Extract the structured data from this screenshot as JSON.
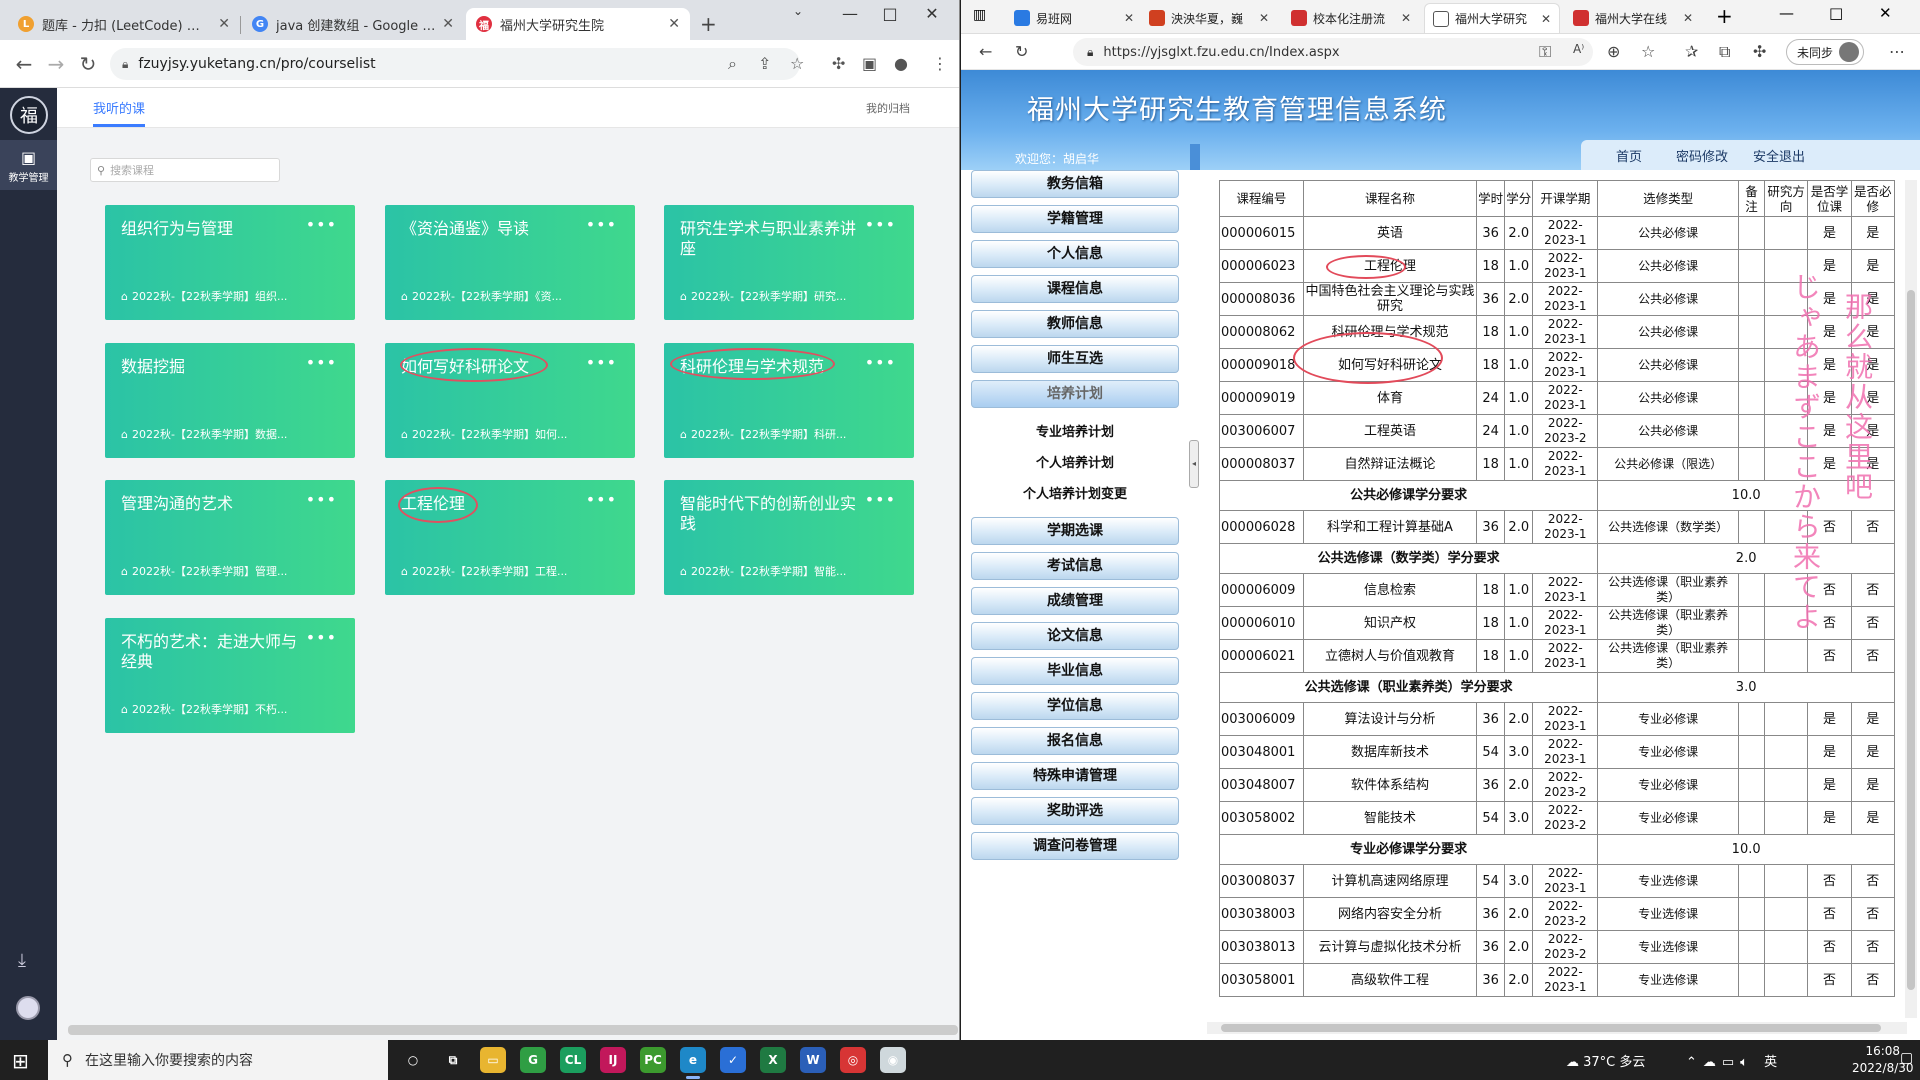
{
  "left_browser": {
    "tabs": [
      {
        "title": "题库 - 力扣 (LeetCode) 全球极",
        "color": "#f0a030"
      },
      {
        "title": "java 创建数组 - Google 搜索",
        "color": "#4285f4"
      },
      {
        "title": "福州大学研究生院",
        "color": "#e03040"
      }
    ],
    "url": "fzuyjsy.yuketang.cn/pro/courselist",
    "page": {
      "side_label": "教学管理",
      "tab_label": "我听的课",
      "archive_label": "我的归档",
      "search_placeholder": "搜索课程",
      "courses": [
        {
          "title": "组织行为与管理",
          "sub": "2022秋-【22秋季学期】组织..."
        },
        {
          "title": "《资治通鉴》导读",
          "sub": "2022秋-【22秋季学期】《资..."
        },
        {
          "title": "研究生学术与职业素养讲座",
          "sub": "2022秋-【22秋季学期】研究..."
        },
        {
          "title": "数据挖掘",
          "sub": "2022秋-【22秋季学期】数据..."
        },
        {
          "title": "如何写好科研论文",
          "sub": "2022秋-【22秋季学期】如何..."
        },
        {
          "title": "科研伦理与学术规范",
          "sub": "2022秋-【22秋季学期】科研..."
        },
        {
          "title": "管理沟通的艺术",
          "sub": "2022秋-【22秋季学期】管理..."
        },
        {
          "title": "工程伦理",
          "sub": "2022秋-【22秋季学期】工程..."
        },
        {
          "title": "智能时代下的创新创业实践",
          "sub": "2022秋-【22秋季学期】智能..."
        },
        {
          "title": "不朽的艺术：走进大师与经典",
          "sub": "2022秋-【22秋季学期】不朽..."
        }
      ]
    }
  },
  "right_browser": {
    "tabs": [
      {
        "title": "易班网",
        "color": "#2a7ae2"
      },
      {
        "title": "泱泱华夏，巍",
        "color": "#d04020"
      },
      {
        "title": "校本化注册流",
        "color": "#d03030"
      },
      {
        "title": "福州大学研究",
        "color": "#ffffff"
      },
      {
        "title": "福州大学在线",
        "color": "#d03030"
      }
    ],
    "url": "https://yjsglxt.fzu.edu.cn/Index.aspx",
    "sync_label": "未同步",
    "page": {
      "title": "福州大学研究生教育管理信息系统",
      "welcome": "欢迎您：胡启华",
      "nav": [
        "首页",
        "密码修改",
        "安全退出"
      ],
      "menu_top": [
        "教务信箱",
        "学籍管理",
        "个人信息",
        "课程信息",
        "教师信息",
        "师生互选",
        "培养计划"
      ],
      "menu_sub": [
        "专业培养计划",
        "个人培养计划",
        "个人培养计划变更"
      ],
      "menu_bottom": [
        "学期选课",
        "考试信息",
        "成绩管理",
        "论文信息",
        "毕业信息",
        "学位信息",
        "报名信息",
        "特殊申请管理",
        "奖助评选",
        "调查问卷管理"
      ],
      "table_headers": [
        "课程编号",
        "课程名称",
        "学时",
        "学分",
        "开课学期",
        "选修类型",
        "备注",
        "研究方向",
        "是否学位课",
        "是否必修"
      ],
      "rows": [
        {
          "kind": "c",
          "code": "000006015",
          "name": "英语",
          "hours": "36",
          "credit": "2.0",
          "term": "2022-2023-1",
          "type": "公共必修课",
          "note": "",
          "dir": "",
          "degree": "是",
          "req": "是"
        },
        {
          "kind": "c",
          "code": "000006023",
          "name": "工程伦理",
          "hours": "18",
          "credit": "1.0",
          "term": "2022-2023-1",
          "type": "公共必修课",
          "note": "",
          "dir": "",
          "degree": "是",
          "req": "是"
        },
        {
          "kind": "c",
          "code": "000008036",
          "name": "中国特色社会主义理论与实践研究",
          "hours": "36",
          "credit": "2.0",
          "term": "2022-2023-1",
          "type": "公共必修课",
          "note": "",
          "dir": "",
          "degree": "是",
          "req": "是"
        },
        {
          "kind": "c",
          "code": "000008062",
          "name": "科研伦理与学术规范",
          "hours": "18",
          "credit": "1.0",
          "term": "2022-2023-1",
          "type": "公共必修课",
          "note": "",
          "dir": "",
          "degree": "是",
          "req": "是"
        },
        {
          "kind": "c",
          "code": "000009018",
          "name": "如何写好科研论文",
          "hours": "18",
          "credit": "1.0",
          "term": "2022-2023-1",
          "type": "公共必修课",
          "note": "",
          "dir": "",
          "degree": "是",
          "req": "是"
        },
        {
          "kind": "c",
          "code": "000009019",
          "name": "体育",
          "hours": "24",
          "credit": "1.0",
          "term": "2022-2023-1",
          "type": "公共必修课",
          "note": "",
          "dir": "",
          "degree": "是",
          "req": "是"
        },
        {
          "kind": "c",
          "code": "003006007",
          "name": "工程英语",
          "hours": "24",
          "credit": "1.0",
          "term": "2022-2023-2",
          "type": "公共必修课",
          "note": "",
          "dir": "",
          "degree": "是",
          "req": "是"
        },
        {
          "kind": "c",
          "code": "000008037",
          "name": "自然辩证法概论",
          "hours": "18",
          "credit": "1.0",
          "term": "2022-2023-1",
          "type": "公共必修课（限选）",
          "note": "",
          "dir": "",
          "degree": "是",
          "req": "是"
        },
        {
          "kind": "s",
          "label": "公共必修课学分要求",
          "value": "10.0"
        },
        {
          "kind": "c",
          "code": "000006028",
          "name": "科学和工程计算基础A",
          "hours": "36",
          "credit": "2.0",
          "term": "2022-2023-1",
          "type": "公共选修课（数学类）",
          "note": "",
          "dir": "",
          "degree": "否",
          "req": "否"
        },
        {
          "kind": "s",
          "label": "公共选修课（数学类）学分要求",
          "value": "2.0"
        },
        {
          "kind": "c",
          "code": "000006009",
          "name": "信息检索",
          "hours": "18",
          "credit": "1.0",
          "term": "2022-2023-1",
          "type": "公共选修课（职业素养类）",
          "note": "",
          "dir": "",
          "degree": "否",
          "req": "否"
        },
        {
          "kind": "c",
          "code": "000006010",
          "name": "知识产权",
          "hours": "18",
          "credit": "1.0",
          "term": "2022-2023-1",
          "type": "公共选修课（职业素养类）",
          "note": "",
          "dir": "",
          "degree": "否",
          "req": "否"
        },
        {
          "kind": "c",
          "code": "000006021",
          "name": "立德树人与价值观教育",
          "hours": "18",
          "credit": "1.0",
          "term": "2022-2023-1",
          "type": "公共选修课（职业素养类）",
          "note": "",
          "dir": "",
          "degree": "否",
          "req": "否"
        },
        {
          "kind": "s",
          "label": "公共选修课（职业素养类）学分要求",
          "value": "3.0"
        },
        {
          "kind": "c",
          "code": "003006009",
          "name": "算法设计与分析",
          "hours": "36",
          "credit": "2.0",
          "term": "2022-2023-1",
          "type": "专业必修课",
          "note": "",
          "dir": "",
          "degree": "是",
          "req": "是"
        },
        {
          "kind": "c",
          "code": "003048001",
          "name": "数据库新技术",
          "hours": "54",
          "credit": "3.0",
          "term": "2022-2023-1",
          "type": "专业必修课",
          "note": "",
          "dir": "",
          "degree": "是",
          "req": "是"
        },
        {
          "kind": "c",
          "code": "003048007",
          "name": "软件体系结构",
          "hours": "36",
          "credit": "2.0",
          "term": "2022-2023-2",
          "type": "专业必修课",
          "note": "",
          "dir": "",
          "degree": "是",
          "req": "是"
        },
        {
          "kind": "c",
          "code": "003058002",
          "name": "智能技术",
          "hours": "54",
          "credit": "3.0",
          "term": "2022-2023-2",
          "type": "专业必修课",
          "note": "",
          "dir": "",
          "degree": "是",
          "req": "是"
        },
        {
          "kind": "s",
          "label": "专业必修课学分要求",
          "value": "10.0"
        },
        {
          "kind": "c",
          "code": "003008037",
          "name": "计算机高速网络原理",
          "hours": "54",
          "credit": "3.0",
          "term": "2022-2023-1",
          "type": "专业选修课",
          "note": "",
          "dir": "",
          "degree": "否",
          "req": "否"
        },
        {
          "kind": "c",
          "code": "003038003",
          "name": "网络内容安全分析",
          "hours": "36",
          "credit": "2.0",
          "term": "2022-2023-2",
          "type": "专业选修课",
          "note": "",
          "dir": "",
          "degree": "否",
          "req": "否"
        },
        {
          "kind": "c",
          "code": "003038013",
          "name": "云计算与虚拟化技术分析",
          "hours": "36",
          "credit": "2.0",
          "term": "2022-2023-2",
          "type": "专业选修课",
          "note": "",
          "dir": "",
          "degree": "否",
          "req": "否"
        },
        {
          "kind": "c",
          "code": "003058001",
          "name": "高级软件工程",
          "hours": "36",
          "credit": "2.0",
          "term": "2022-2023-1",
          "type": "专业选修课",
          "note": "",
          "dir": "",
          "degree": "否",
          "req": "否"
        }
      ],
      "annotation_1": "那么就从这里吧",
      "annotation_2": "じゃあまずここから来てよ"
    }
  },
  "taskbar": {
    "search_placeholder": "在这里输入你要搜索的内容",
    "weather": "37°C 多云",
    "ime": "英",
    "time": "16:08",
    "date": "2022/8/30",
    "apps": [
      {
        "label": "○",
        "color": "transparent"
      },
      {
        "label": "⧉",
        "color": "transparent"
      },
      {
        "label": "▭",
        "color": "#e8b530"
      },
      {
        "label": "G",
        "color": "#2f9e44"
      },
      {
        "label": "CL",
        "color": "#1b9e5e"
      },
      {
        "label": "IJ",
        "color": "#c2185b"
      },
      {
        "label": "PC",
        "color": "#3c9a2e"
      },
      {
        "label": "e",
        "color": "#1e88c8"
      },
      {
        "label": "✓",
        "color": "#2a6fd6"
      },
      {
        "label": "X",
        "color": "#1f7a42"
      },
      {
        "label": "W",
        "color": "#2b5fb8"
      },
      {
        "label": "◎",
        "color": "#d73535"
      },
      {
        "label": "◉",
        "color": "#cfd8dc"
      }
    ]
  }
}
